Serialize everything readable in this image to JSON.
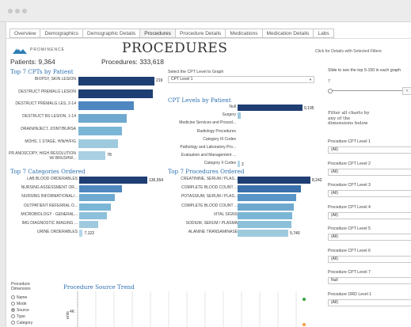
{
  "tabs": [
    "Overview",
    "Demographics",
    "Demographic Details",
    "Procedures",
    "Procedure Details",
    "Medications",
    "Medication Details",
    "Labs"
  ],
  "active_tab": "Procedures",
  "logo_text": "PROMINENCE",
  "page_title": "PROCEDURES",
  "patients_label": "Patients: 9,364",
  "procedures_label": "Procedures: 333,618",
  "click_note": "Click for Details with Selected Filters",
  "top_cpt": {
    "title": "Top 7 CPTs by Patient",
    "items": [
      {
        "label": "BIOPSY, SKIN LESION",
        "value": 219,
        "color": "#1f3e73"
      },
      {
        "label": "DESTRUCT PREMALG LESION",
        "value": 215,
        "color": "#1f3e73"
      },
      {
        "label": "DESTRUCT PREMALG LES, 2-14",
        "value": 160,
        "color": "#4f87c0"
      },
      {
        "label": "DESTRUCT BS LESION, 1-14",
        "value": 140,
        "color": "#6fa9cf"
      },
      {
        "label": "DRAIN/INJECT, JOINT/BURSA",
        "value": 125,
        "color": "#7cb6d6"
      },
      {
        "label": "MOHS, 1 STAGE, H/N/H/F/G",
        "value": 115,
        "color": "#9fcade"
      },
      {
        "label": "PR ANOSCOPY, HIGH RESOLUTION W/ BRUSHW...",
        "value": 78,
        "color": "#a9d0e3"
      }
    ],
    "visible_values": [
      "219",
      "78"
    ]
  },
  "cpt_level_select": {
    "label": "Select the CPT Level to Graph",
    "value": "CPT Level 1"
  },
  "cpt_levels": {
    "title": "CPT Levels by Patient",
    "items": [
      {
        "label": "Null",
        "value": 9195,
        "color": "#1f3e73"
      },
      {
        "label": "Surgery",
        "value": 450,
        "color": "#9fcade"
      },
      {
        "label": "Medicine Services and Proced...",
        "value": 0,
        "color": "#b5d7e8"
      },
      {
        "label": "Radiology Procedures",
        "value": 0,
        "color": "#b5d7e8"
      },
      {
        "label": "Category III Codes",
        "value": 0,
        "color": "#b5d7e8"
      },
      {
        "label": "Pathology and Laboratory Pro...",
        "value": 0,
        "color": "#b5d7e8"
      },
      {
        "label": "Evaluation and Management ...",
        "value": 0,
        "color": "#b5d7e8"
      },
      {
        "label": "Category II Codes",
        "value": 2,
        "color": "#b5d7e8"
      }
    ],
    "visible_values": [
      "9,195",
      "2"
    ]
  },
  "top_categories": {
    "title": "Top 7 Categories Ordered",
    "items": [
      {
        "label": "LAB BLOOD ORDERABLES",
        "value": 136554,
        "color": "#1f3e73"
      },
      {
        "label": "NURSING ASSESSMENT OR...",
        "value": 85000,
        "color": "#4f87c0"
      },
      {
        "label": "NURSING INFORMATIONAL/...",
        "value": 72000,
        "color": "#6fa9cf"
      },
      {
        "label": "OUTPATIENT REFERRAL O...",
        "value": 64000,
        "color": "#7cb6d6"
      },
      {
        "label": "MICROBIOLOGY - GENERAL...",
        "value": 55000,
        "color": "#8dc0da"
      },
      {
        "label": "IMG DIAGNOSTIC IMAGING ...",
        "value": 38000,
        "color": "#9fcade"
      },
      {
        "label": "URINE ORDERABLES",
        "value": 7122,
        "color": "#b5d7e8"
      }
    ],
    "visible_values": [
      "136,554",
      "7,122"
    ]
  },
  "top_procedures": {
    "title": "Top 7 Procedures Ordered",
    "items": [
      {
        "label": "CREATININE, SERUM / PLAS...",
        "value": 8242,
        "color": "#1f3e73"
      },
      {
        "label": "COMPLETE BLOOD COUNT ...",
        "value": 7200,
        "color": "#3a70ab"
      },
      {
        "label": "POTASSIUM, SERUM / PLAS...",
        "value": 6600,
        "color": "#5995c6"
      },
      {
        "label": "COMPLETE BLOOD COUNT ...",
        "value": 6400,
        "color": "#6fa9cf"
      },
      {
        "label": "VITAL SIGNS",
        "value": 6200,
        "color": "#7cb6d6"
      },
      {
        "label": "SODIUM, SERUM / PLASMA",
        "value": 6050,
        "color": "#8dc0da"
      },
      {
        "label": "ALANINE TRANSAMINASE",
        "value": 5740,
        "color": "#9fcade"
      }
    ],
    "visible_values": [
      "8,242",
      "5,740"
    ]
  },
  "slider": {
    "label": "Slide to see the top 5-150 in each graph",
    "value": "7"
  },
  "filter_note": "Filter all charts by any of the dimensions below",
  "filters": [
    {
      "label": "Procedure CPT Level 1",
      "value": "(All)"
    },
    {
      "label": "Procedure CPT Level 2",
      "value": "(All)"
    },
    {
      "label": "Procedure CPT Level 3",
      "value": "(All)"
    },
    {
      "label": "Procedure CPT Level 4",
      "value": "(All)"
    },
    {
      "label": "Procedure CPT Level 5",
      "value": "(All)"
    },
    {
      "label": "Procedure CPT Level 6",
      "value": "(All)"
    },
    {
      "label": "Procedure CPT Level 7",
      "value": "Null"
    },
    {
      "label": "Procedure ORD Level 1",
      "value": "(All)"
    }
  ],
  "dimension": {
    "label": "Procedure Dimension",
    "options": [
      "Name",
      "Mode",
      "Source",
      "Type",
      "Category"
    ],
    "selected": "Source"
  },
  "trend": {
    "title": "Procedure Source Trend",
    "ytick": "4K",
    "ylabel": "ents",
    "point_colors": [
      "#3aa040",
      "#f39c3a"
    ]
  }
}
